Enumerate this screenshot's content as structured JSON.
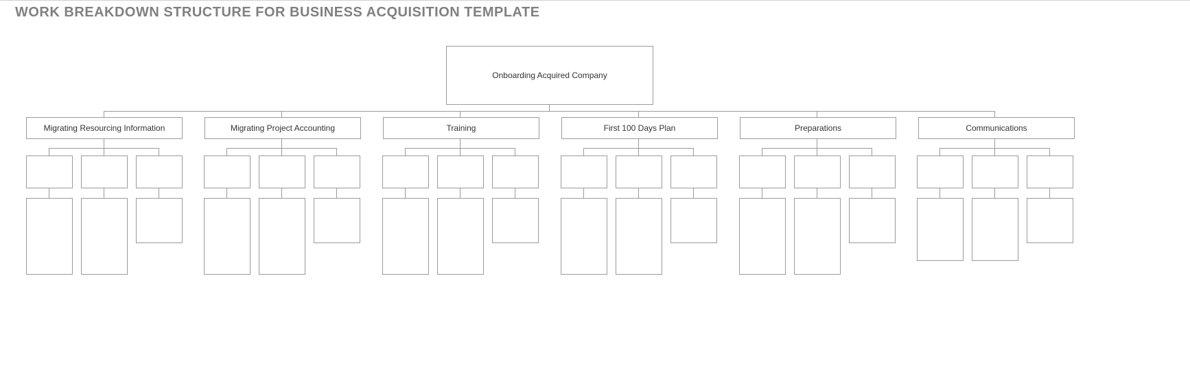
{
  "title": "WORK BREAKDOWN STRUCTURE FOR BUSINESS ACQUISITION TEMPLATE",
  "root": "Onboarding Acquired Company",
  "categories": [
    "Migrating Resourcing Information",
    "Migrating Project Accounting",
    "Training",
    "First 100 Days Plan",
    "Preparations",
    "Communications"
  ]
}
